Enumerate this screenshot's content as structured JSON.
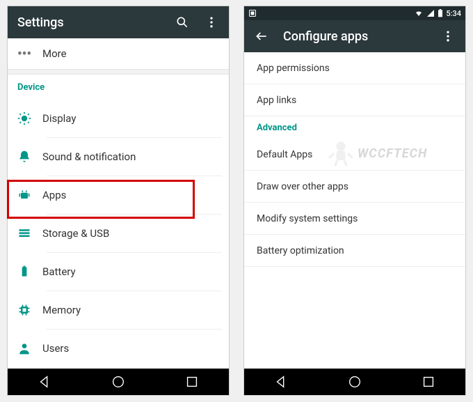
{
  "left": {
    "appbar": {
      "title": "Settings"
    },
    "more_label": "More",
    "device_header": "Device",
    "items": [
      {
        "name": "display",
        "label": "Display"
      },
      {
        "name": "sound",
        "label": "Sound & notification"
      },
      {
        "name": "apps",
        "label": "Apps"
      },
      {
        "name": "storage",
        "label": "Storage & USB"
      },
      {
        "name": "battery",
        "label": "Battery"
      },
      {
        "name": "memory",
        "label": "Memory"
      },
      {
        "name": "users",
        "label": "Users"
      }
    ],
    "highlighted": "apps"
  },
  "right": {
    "status_time": "5:34",
    "appbar": {
      "title": "Configure apps"
    },
    "items_top": [
      {
        "name": "app-permissions",
        "label": "App permissions"
      },
      {
        "name": "app-links",
        "label": "App links"
      }
    ],
    "advanced_header": "Advanced",
    "items_advanced": [
      {
        "name": "default-apps",
        "label": "Default Apps"
      },
      {
        "name": "draw-over-other-apps",
        "label": "Draw over other apps"
      },
      {
        "name": "modify-system",
        "label": "Modify system settings"
      },
      {
        "name": "battery-optimization",
        "label": "Battery optimization"
      }
    ]
  },
  "watermark": "WCCFTECH"
}
